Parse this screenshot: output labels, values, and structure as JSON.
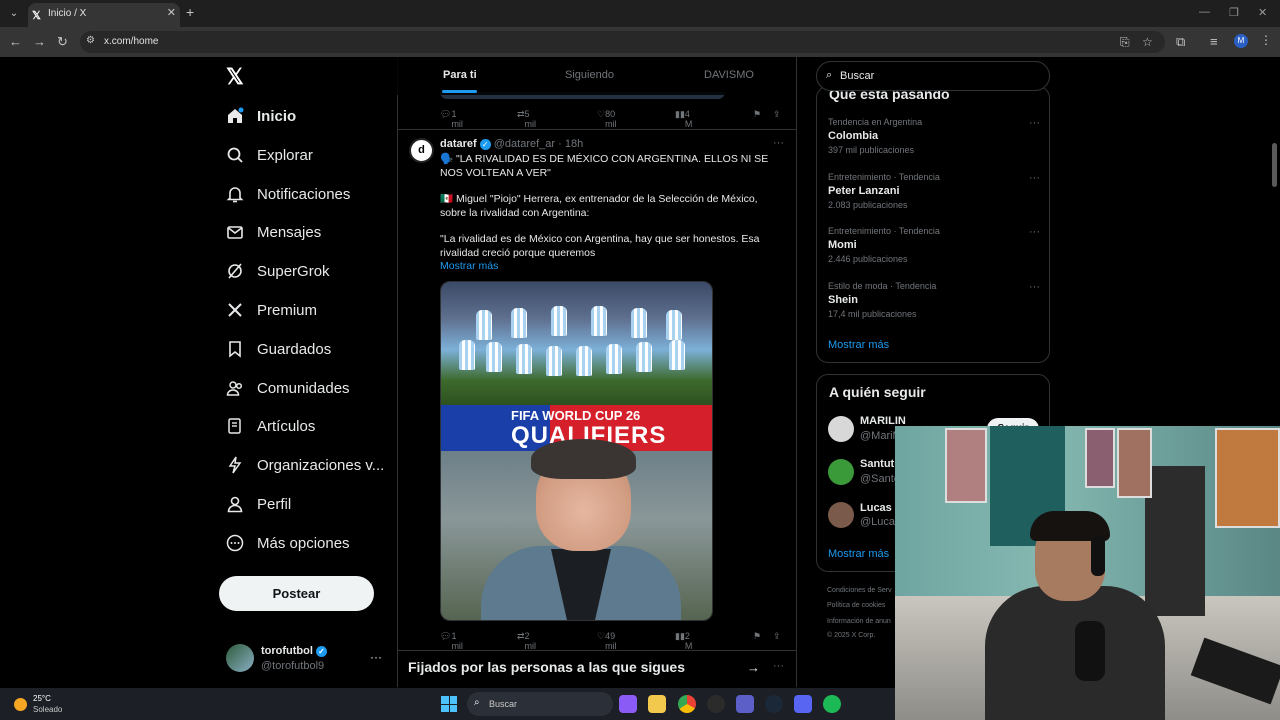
{
  "browser": {
    "tab_title": "Inicio / X",
    "url": "x.com/home"
  },
  "nav": {
    "items": [
      {
        "label": "Inicio",
        "icon": "home-icon"
      },
      {
        "label": "Explorar",
        "icon": "search-icon"
      },
      {
        "label": "Notificaciones",
        "icon": "bell-icon"
      },
      {
        "label": "Mensajes",
        "icon": "mail-icon"
      },
      {
        "label": "SuperGrok",
        "icon": "grok-icon"
      },
      {
        "label": "Premium",
        "icon": "x-icon"
      },
      {
        "label": "Guardados",
        "icon": "bookmark-icon"
      },
      {
        "label": "Comunidades",
        "icon": "people-icon"
      },
      {
        "label": "Artículos",
        "icon": "article-icon"
      },
      {
        "label": "Organizaciones v...",
        "icon": "lightning-icon"
      },
      {
        "label": "Perfil",
        "icon": "person-icon"
      },
      {
        "label": "Más opciones",
        "icon": "more-circle-icon"
      }
    ],
    "post_label": "Postear",
    "account": {
      "name": "torofutbol",
      "handle": "@torofutbol9"
    }
  },
  "feed": {
    "tabs": [
      "Para ti",
      "Siguiendo",
      "DAVISMO"
    ],
    "prev_actions": {
      "replies": "1 mil",
      "reposts": "5 mil",
      "likes": "80 mil",
      "views": "4 M"
    },
    "tweet": {
      "name": "dataref",
      "handle": "@dataref_ar",
      "time": "18h",
      "avatar_letter": "d",
      "line1": "🗣️ \"LA RIVALIDAD ES DE MÉXICO CON ARGENTINA. ELLOS NI SE NOS VOLTEAN A VER\"",
      "line2": "🇲🇽 Miguel \"Piojo\" Herrera, ex entrenador de la Selección de México, sobre la rivalidad con Argentina:",
      "line3": "\"La rivalidad es de México con Argentina, hay que ser honestos. Esa rivalidad creció porque queremos",
      "show_more": "Mostrar más",
      "image_banner_top": "FIFA WORLD CUP 26",
      "image_banner_main": "QUALIFIERS",
      "actions": {
        "replies": "1 mil",
        "reposts": "2 mil",
        "likes": "49 mil",
        "views": "2 M"
      }
    },
    "pinned_title": "Fijados por las personas a las que sigues"
  },
  "right": {
    "search_placeholder": "Buscar",
    "trends_title": "Qué está pasando",
    "trends": [
      {
        "context": "Tendencia en Argentina",
        "name": "Colombia",
        "count": "397 mil publicaciones"
      },
      {
        "context": "Entretenimiento · Tendencia",
        "name": "Peter Lanzani",
        "count": "2.083 publicaciones"
      },
      {
        "context": "Entretenimiento · Tendencia",
        "name": "Momi",
        "count": "2.446 publicaciones"
      },
      {
        "context": "Estilo de moda · Tendencia",
        "name": "Shein",
        "count": "17,4 mil publicaciones"
      }
    ],
    "show_more": "Mostrar más",
    "follow_title": "A quién seguir",
    "follow": [
      {
        "name": "MARILIN",
        "handle": "@MariM"
      },
      {
        "name": "Santutu",
        "handle": "@Sante"
      },
      {
        "name": "Lucas R",
        "handle": "@Lucas"
      }
    ],
    "follow_button": "Seguir",
    "footer": [
      "Condiciones de Serv",
      "Política de cookies",
      "Información de anun",
      "© 2025 X Corp."
    ]
  },
  "taskbar": {
    "temp": "25°C",
    "weather": "Soleado",
    "search": "Buscar"
  }
}
